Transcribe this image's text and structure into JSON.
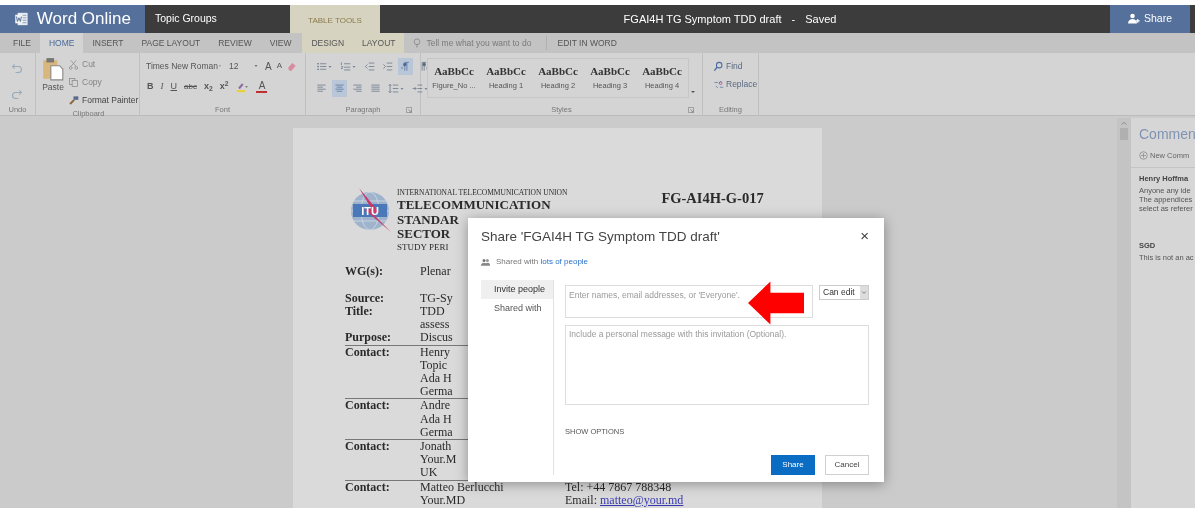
{
  "app": {
    "name": "Word Online",
    "location": "Topic Groups",
    "context_group": "TABLE TOOLS",
    "document_title": "FGAI4H TG Symptom TDD draft",
    "title_separator": "-",
    "save_status": "Saved",
    "share_button": "Share"
  },
  "ribbon_tabs": [
    {
      "label": "FILE",
      "selected": false,
      "contextual": false
    },
    {
      "label": "HOME",
      "selected": true,
      "contextual": false
    },
    {
      "label": "INSERT",
      "selected": false,
      "contextual": false
    },
    {
      "label": "PAGE LAYOUT",
      "selected": false,
      "contextual": false
    },
    {
      "label": "REVIEW",
      "selected": false,
      "contextual": false
    },
    {
      "label": "VIEW",
      "selected": false,
      "contextual": false
    },
    {
      "label": "DESIGN",
      "selected": false,
      "contextual": true
    },
    {
      "label": "LAYOUT",
      "selected": false,
      "contextual": true
    }
  ],
  "tell_me": {
    "placeholder": "Tell me what you want to do"
  },
  "edit_in_word": "EDIT IN WORD",
  "undo_group": {
    "label": "Undo"
  },
  "clipboard": {
    "paste": "Paste",
    "label": "Clipboard",
    "items": [
      {
        "label": "Cut",
        "kind": "cut",
        "disabled": true
      },
      {
        "label": "Copy",
        "kind": "copy",
        "disabled": true
      },
      {
        "label": "Format Painter",
        "kind": "painter",
        "disabled": false
      }
    ]
  },
  "font": {
    "name": "Times New Roman",
    "size": "12",
    "label": "Font",
    "color_button": "A",
    "size_buttons": [
      {
        "label": "A",
        "kind": "grow"
      },
      {
        "label": "A",
        "kind": "shrink"
      }
    ],
    "format_buttons": [
      {
        "label": "B",
        "kind": "bold"
      },
      {
        "label": "I",
        "kind": "italic"
      },
      {
        "label": "U",
        "kind": "underline"
      },
      {
        "label": "abc",
        "kind": "strike"
      },
      {
        "label": "x$_{2}$",
        "kind": "script"
      },
      {
        "label": "x$^{2}$",
        "kind": "script"
      }
    ]
  },
  "paragraph": {
    "label": "Paragraph",
    "rows": [
      [
        {
          "kind": "bullets",
          "selected": false
        },
        {
          "kind": "numbering",
          "selected": false
        },
        {
          "kind": "outdent",
          "selected": false
        },
        {
          "kind": "indent",
          "selected": false
        },
        {
          "kind": "ltr",
          "selected": true
        },
        {
          "kind": "rtl",
          "selected": false
        }
      ],
      [
        {
          "kind": "align-left",
          "selected": false
        },
        {
          "kind": "align-center",
          "selected": true
        },
        {
          "kind": "align-right",
          "selected": false
        },
        {
          "kind": "justify",
          "selected": false
        },
        {
          "kind": "line-spacing",
          "selected": false
        },
        {
          "kind": "para-spacing",
          "selected": false
        }
      ]
    ]
  },
  "styles": {
    "label": "Styles",
    "items": [
      {
        "sample": "AaBbCc",
        "name": "Figure_No ..."
      },
      {
        "sample": "AaBbCc",
        "name": "Heading 1"
      },
      {
        "sample": "AaBbCc",
        "name": "Heading 2"
      },
      {
        "sample": "AaBbCc",
        "name": "Heading 3"
      },
      {
        "sample": "AaBbCc",
        "name": "Heading 4"
      }
    ]
  },
  "editing": {
    "label": "Editing",
    "items": [
      {
        "label": "Find",
        "kind": "find"
      },
      {
        "label": "Replace",
        "kind": "replace"
      }
    ]
  },
  "document": {
    "logo_text": "ITU",
    "org_line": "INTERNATIONAL TELECOMMUNICATION UNION",
    "sector_lines": [
      "TELECOMMUNICATION",
      "STANDAR",
      "SECTOR"
    ],
    "study_period": "STUDY PERI",
    "doc_number": "FG-AI4H-G-017",
    "rows": [
      {
        "label": "WG(s):",
        "lines": [
          "Plenar"
        ],
        "divider_above": false
      },
      {
        "label": "Source:",
        "lines": [
          "TG-Sy"
        ],
        "divider_above": false
      },
      {
        "label": "Title:",
        "lines": [
          "TDD",
          "assess"
        ],
        "divider_above": false
      },
      {
        "label": "Purpose:",
        "lines": [
          "Discus"
        ],
        "divider_above": false
      },
      {
        "label": "Contact:",
        "lines": [
          "Henry",
          "Topic",
          "Ada H",
          "Germa"
        ],
        "divider_above": true
      },
      {
        "label": "Contact:",
        "lines": [
          "Andre",
          "Ada H",
          "Germa"
        ],
        "divider_above": true
      },
      {
        "label": "Contact:",
        "lines": [
          "Jonath",
          "Your.M",
          "UK"
        ],
        "divider_above": true
      },
      {
        "label": "Contact:",
        "lines": [
          "Matteo Berlucchi",
          "Your.MD"
        ],
        "divider_above": true,
        "details": [
          {
            "text": "Tel: +44 7867 788348"
          },
          {
            "text": "Email:",
            "link": "matteo@your.md"
          }
        ]
      }
    ]
  },
  "comments_pane": {
    "title": "Commen",
    "new_comment": "New Comm",
    "comments": [
      {
        "author": "Henry Hoffma",
        "lines": [
          "Anyone any ide",
          "The appendices",
          "select as referer"
        ]
      },
      {
        "author": "SGD",
        "lines": [
          "This is not an ac"
        ]
      }
    ]
  },
  "share_dialog": {
    "title": "Share 'FGAI4H TG Symptom TDD draft'",
    "close": "×",
    "shared_with": {
      "text": "Shared with",
      "link": "lots of people"
    },
    "side_tabs": [
      {
        "label": "Invite people",
        "selected": true
      },
      {
        "label": "Shared with",
        "selected": false
      }
    ],
    "invite": {
      "placeholder": "Enter names, email addresses, or 'Everyone'."
    },
    "permission": "Can edit",
    "message": {
      "placeholder": "Include a personal message with this invitation (Optional)."
    },
    "show_options": "SHOW OPTIONS",
    "buttons": [
      {
        "label": "Share",
        "kind": "primary"
      },
      {
        "label": "Cancel",
        "kind": "secondary"
      }
    ]
  }
}
